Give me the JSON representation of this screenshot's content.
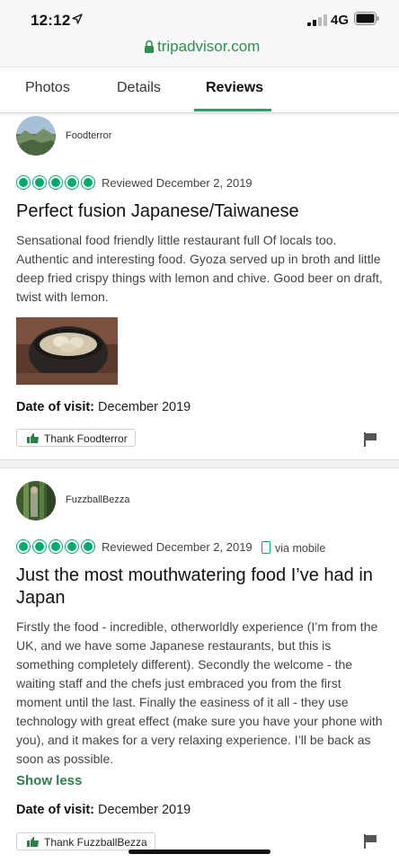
{
  "status_bar": {
    "time": "12:12",
    "network": "4G"
  },
  "browser": {
    "url": "tripadvisor.com"
  },
  "tabs": [
    {
      "label": "Photos"
    },
    {
      "label": "Details"
    },
    {
      "label": "Reviews",
      "active": true
    }
  ],
  "reviews": [
    {
      "username": "Foodterror",
      "rating_bubbles": 5,
      "reviewed": "Reviewed December 2, 2019",
      "title": "Perfect fusion Japanese/Taiwanese",
      "body": "Sensational food friendly little restaurant full Of locals too. Authentic and interesting food. Gyoza served up in broth and little deep fried crispy things with lemon and chive. Good beer on draft, twist with lemon.",
      "visit_label": "Date of visit:",
      "visit_date": "December 2019",
      "thank_label": "Thank Foodterror"
    },
    {
      "username": "FuzzballBezza",
      "rating_bubbles": 5,
      "reviewed": "Reviewed December 2, 2019",
      "via": "via mobile",
      "title": "Just the most mouthwatering food I’ve had in Japan",
      "body": "Firstly the food - incredible, otherworldly experience (I’m from the UK, and we have some Japanese restaurants, but this is something completely different). Secondly the welcome - the waiting staff and the chefs just embraced you from the first moment until the last. Finally the easiness of it all - they use technology with great effect (make sure you have your phone with you), and it makes for a very relaxing experience. I’ll be back as soon as possible.",
      "show_less": "Show less",
      "visit_label": "Date of visit:",
      "visit_date": "December 2019",
      "thank_label": "Thank FuzzballBezza"
    }
  ],
  "colors": {
    "accent_green": "#00aa6c",
    "tab_underline": "#2e9b6a",
    "url_green": "#2f8f4f"
  }
}
